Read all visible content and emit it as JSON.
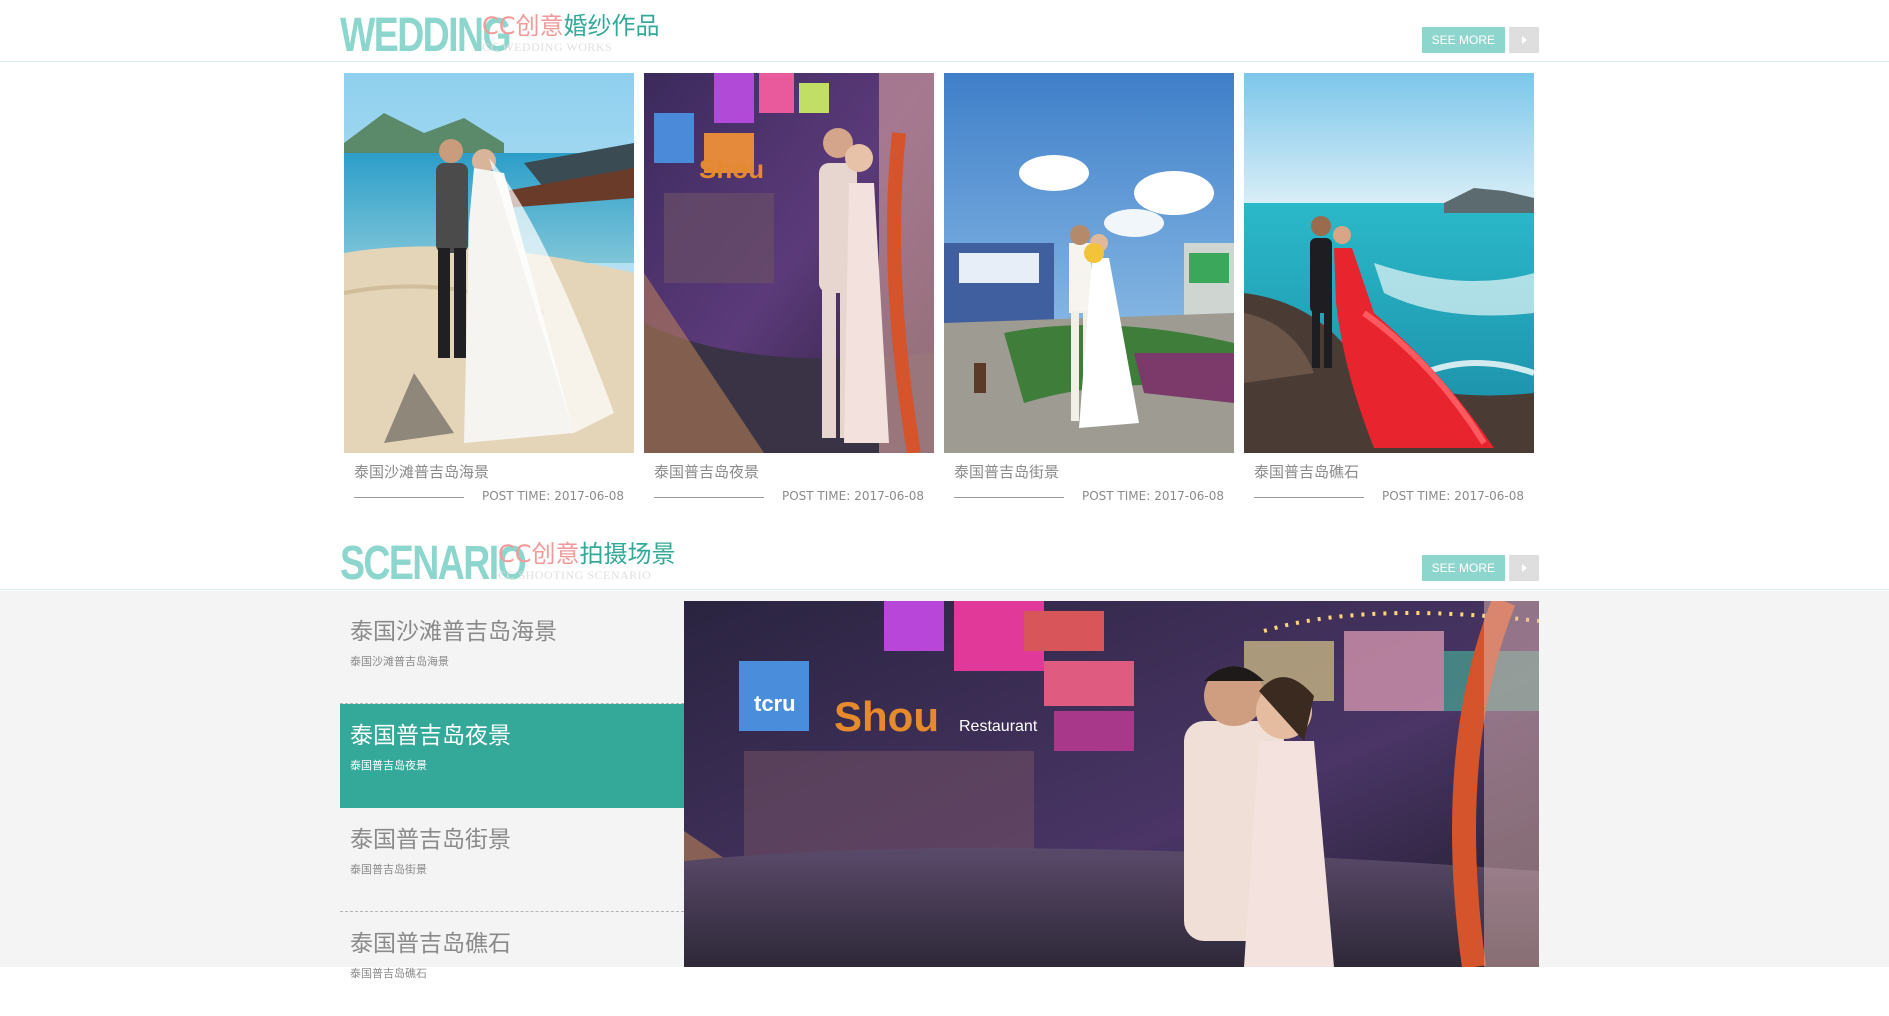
{
  "wedding_section": {
    "big_word": "WEDDING",
    "title_cc": "CC创意",
    "title_rest": "婚纱作品",
    "subtitle": "CC WEDDING WORKS",
    "see_more": "SEE MORE",
    "cards": [
      {
        "title": "泰国沙滩普吉岛海景",
        "post_label": "POST TIME:",
        "date": "2017-06-08",
        "scene": "beach"
      },
      {
        "title": "泰国普吉岛夜景",
        "post_label": "POST TIME:",
        "date": "2017-06-08",
        "scene": "night"
      },
      {
        "title": "泰国普吉岛街景",
        "post_label": "POST TIME:",
        "date": "2017-06-08",
        "scene": "street"
      },
      {
        "title": "泰国普吉岛礁石",
        "post_label": "POST TIME:",
        "date": "2017-06-08",
        "scene": "reef"
      }
    ]
  },
  "scenario_section": {
    "big_word": "SCENARIO",
    "title_cc": "CC创意",
    "title_rest": "拍摄场景",
    "subtitle": "CC SHOOTING SCENARIO",
    "see_more": "SEE MORE",
    "items": [
      {
        "title": "泰国沙滩普吉岛海景",
        "subtitle": "泰国沙滩普吉岛海景",
        "active": false
      },
      {
        "title": "泰国普吉岛夜景",
        "subtitle": "泰国普吉岛夜景",
        "active": true
      },
      {
        "title": "泰国普吉岛街景",
        "subtitle": "泰国普吉岛街景",
        "active": false
      },
      {
        "title": "泰国普吉岛礁石",
        "subtitle": "泰国普吉岛礁石",
        "active": false
      }
    ]
  },
  "colors": {
    "accent": "#34a99a",
    "accent_light": "#8dd6cd",
    "pink": "#f29a9a",
    "muted_text": "#8a8a8a"
  }
}
